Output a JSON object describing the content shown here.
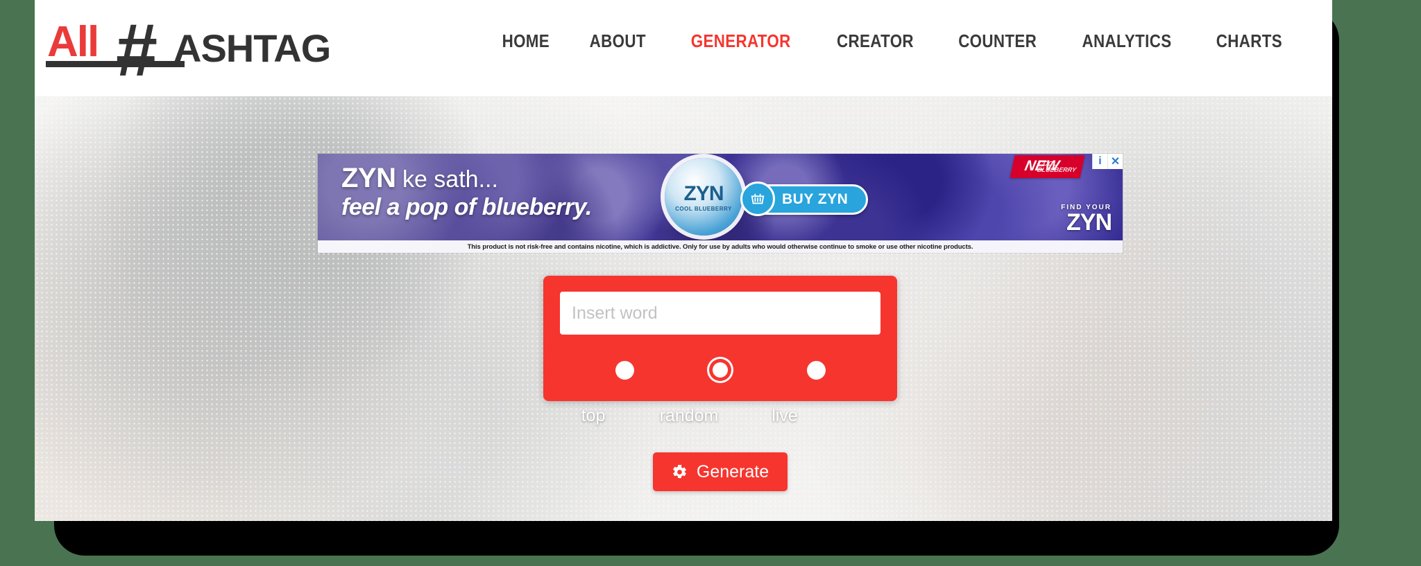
{
  "colors": {
    "page_background": "#497351",
    "brand_red": "#f6352f",
    "logo_red": "#ea3b3b",
    "logo_dark": "#333333",
    "nav_text": "#3a3a3a"
  },
  "header": {
    "logo": {
      "part_red": "All",
      "part_hash": "#",
      "part_dark": "ASHTAG"
    },
    "nav": [
      {
        "label": "HOME",
        "active": false
      },
      {
        "label": "ABOUT",
        "active": false
      },
      {
        "label": "GENERATOR",
        "active": true
      },
      {
        "label": "CREATOR",
        "active": false
      },
      {
        "label": "COUNTER",
        "active": false
      },
      {
        "label": "ANALYTICS",
        "active": false
      },
      {
        "label": "CHARTS",
        "active": false
      }
    ]
  },
  "ad": {
    "headline_brand": "ZYN",
    "headline_rest": " ke sath...",
    "headline_line2": "feel a pop of blueberry.",
    "can_brand": "ZYN",
    "can_flavor": "COOL BLUEBERRY",
    "buy_label": "BUY ZYN",
    "basket_icon": "basket-icon",
    "new_badge": "NEW",
    "new_badge_sub": "COOL BLUEBERRY",
    "find_your_small": "FIND YOUR",
    "find_your_big": "ZYN",
    "adchoices_info": "i",
    "adchoices_close": "✕",
    "disclaimer": "This product is not risk-free and contains nicotine, which is addictive. Only for use by adults who would otherwise continue to smoke or use other nicotine products."
  },
  "generator": {
    "input_value": "",
    "input_placeholder": "Insert word",
    "options": [
      {
        "label": "top",
        "selected": false
      },
      {
        "label": "random",
        "selected": true
      },
      {
        "label": "live",
        "selected": false
      }
    ],
    "generate_label": "Generate",
    "generate_icon": "gear-icon"
  }
}
